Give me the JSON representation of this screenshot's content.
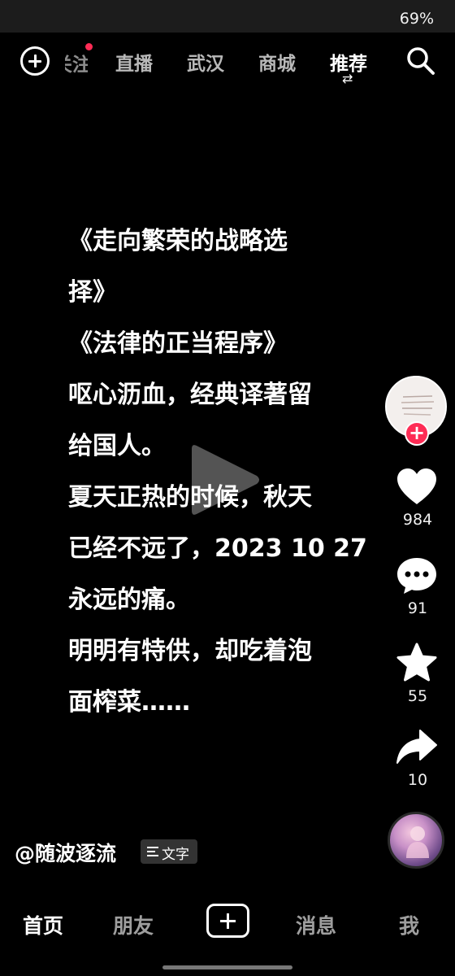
{
  "status_bar": {
    "battery": "69%"
  },
  "top_nav": {
    "partial_tab": "关注",
    "tabs": [
      "直播",
      "武汉",
      "商城",
      "推荐"
    ],
    "active_tab_arrows": "⇄"
  },
  "video": {
    "lines": [
      "《走向繁荣的战略选",
      "择》",
      "《法律的正当程序》",
      "呕心沥血，经典译著留",
      "给国人。",
      "夏天正热的时候，秋天",
      "已经不远了，2023 10 27",
      "永远的痛。",
      "明明有特供，却吃着泡",
      "面榨菜……"
    ]
  },
  "rail": {
    "follow_badge": "+",
    "likes": "984",
    "comments": "91",
    "favorites": "55",
    "shares": "10"
  },
  "author": {
    "name": "@随波逐流",
    "text_chip": "文字"
  },
  "bottom_nav": {
    "home": "首页",
    "friends": "朋友",
    "messages": "消息",
    "me": "我"
  },
  "colors": {
    "accent": "#fe2c55",
    "background": "#000000"
  }
}
